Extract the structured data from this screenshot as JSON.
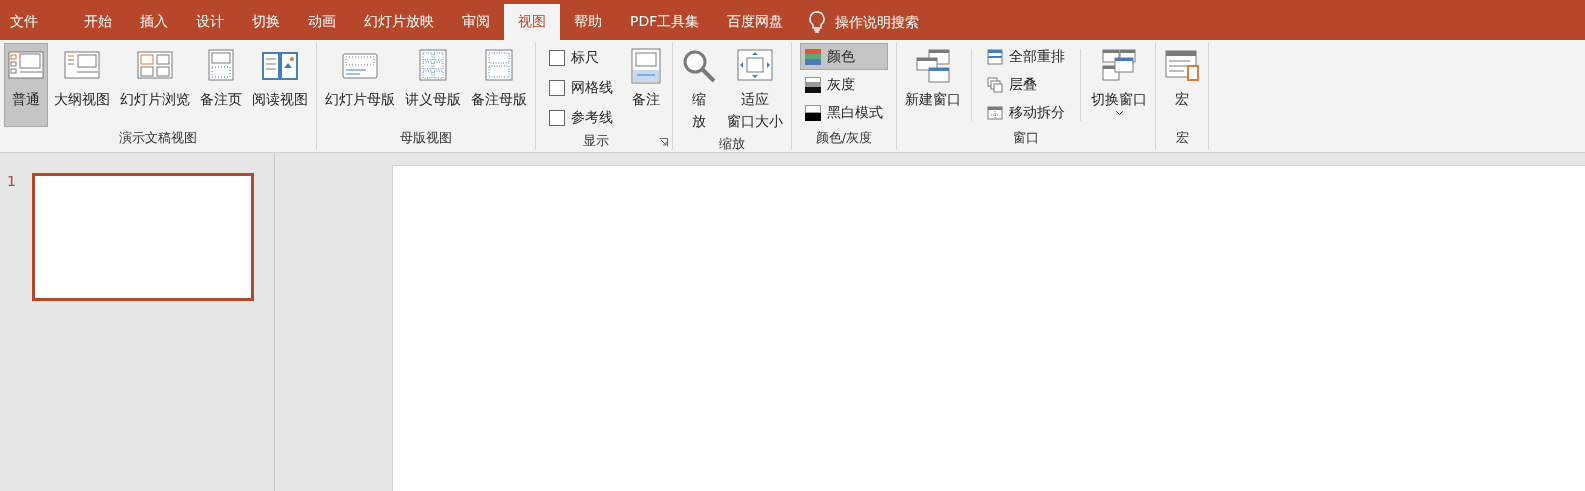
{
  "tabs": [
    {
      "label": "文件",
      "selected": false
    },
    {
      "label": "开始",
      "selected": false
    },
    {
      "label": "插入",
      "selected": false
    },
    {
      "label": "设计",
      "selected": false
    },
    {
      "label": "切换",
      "selected": false
    },
    {
      "label": "动画",
      "selected": false
    },
    {
      "label": "幻灯片放映",
      "selected": false
    },
    {
      "label": "审阅",
      "selected": false
    },
    {
      "label": "视图",
      "selected": true
    },
    {
      "label": "帮助",
      "selected": false
    },
    {
      "label": "PDF工具集",
      "selected": false
    },
    {
      "label": "百度网盘",
      "selected": false
    }
  ],
  "search": {
    "placeholder": "操作说明搜索"
  },
  "groups": [
    {
      "label": "演示文稿视图",
      "items": [
        {
          "kind": "large",
          "label": "普通",
          "selected": true
        },
        {
          "kind": "large",
          "label": "大纲视图",
          "selected": false
        },
        {
          "kind": "large",
          "label": "幻灯片浏览",
          "selected": false
        },
        {
          "kind": "large",
          "label": "备注页",
          "selected": false
        },
        {
          "kind": "large",
          "label": "阅读视图",
          "selected": false
        }
      ]
    },
    {
      "label": "母版视图",
      "items": [
        {
          "kind": "large",
          "label": "幻灯片母版",
          "selected": false
        },
        {
          "kind": "large",
          "label": "讲义母版",
          "selected": false
        },
        {
          "kind": "large",
          "label": "备注母版",
          "selected": false
        }
      ]
    },
    {
      "label": "显示",
      "launcher": true,
      "items": [
        {
          "kind": "stack",
          "entries": [
            {
              "kind": "checkbox",
              "label": "标尺",
              "checked": false
            },
            {
              "kind": "checkbox",
              "label": "网格线",
              "checked": false
            },
            {
              "kind": "checkbox",
              "label": "参考线",
              "checked": false
            }
          ]
        },
        {
          "kind": "large",
          "label": "备注",
          "selected": false
        }
      ]
    },
    {
      "label": "缩放",
      "items": [
        {
          "kind": "large",
          "lines": [
            "缩",
            "放"
          ],
          "selected": false
        },
        {
          "kind": "large",
          "lines": [
            "适应",
            "窗口大小"
          ],
          "selected": false
        }
      ]
    },
    {
      "label": "颜色/灰度",
      "items": [
        {
          "kind": "stack",
          "entries": [
            {
              "kind": "option",
              "label": "颜色",
              "selected": true
            },
            {
              "kind": "option",
              "label": "灰度",
              "selected": false
            },
            {
              "kind": "option",
              "label": "黑白模式",
              "selected": false
            }
          ]
        }
      ]
    },
    {
      "label": "窗口",
      "items": [
        {
          "kind": "large",
          "label": "新建窗口",
          "selected": false
        },
        {
          "kind": "stack",
          "entries": [
            {
              "kind": "option",
              "label": "全部重排",
              "selected": false
            },
            {
              "kind": "option",
              "label": "层叠",
              "selected": false
            },
            {
              "kind": "option",
              "label": "移动拆分",
              "selected": false
            }
          ]
        },
        {
          "kind": "large",
          "label": "切换窗口",
          "selected": false,
          "dropdown": true
        }
      ]
    },
    {
      "label": "宏",
      "items": [
        {
          "kind": "large",
          "label": "宏",
          "selected": false
        }
      ]
    }
  ],
  "thumbnails": [
    {
      "number": "1",
      "selected": true
    }
  ]
}
